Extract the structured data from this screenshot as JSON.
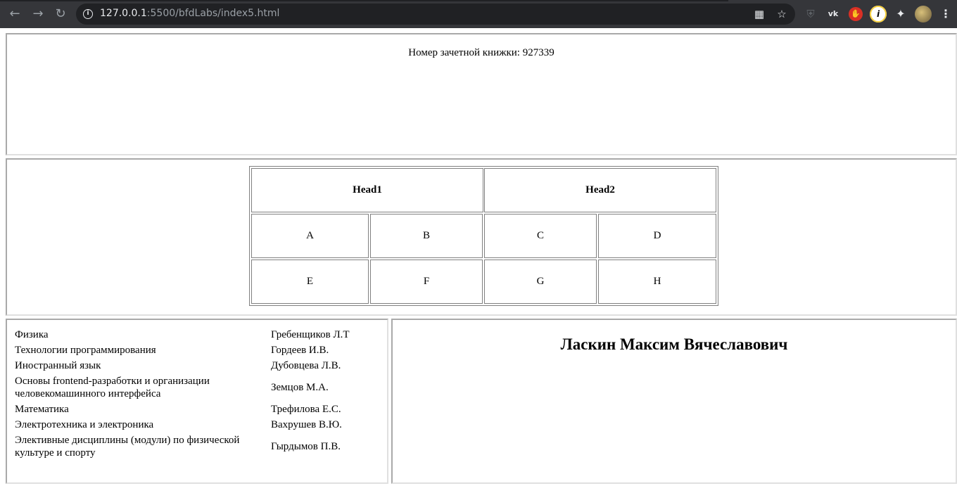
{
  "browser": {
    "url_host": "127.0.0.1",
    "url_rest": ":5500/bfdLabs/index5.html",
    "back_icon": "arrow-left-icon",
    "forward_icon": "arrow-right-icon",
    "reload_icon": "reload-icon"
  },
  "header": {
    "record_book": "Номер зачетной книжки: 927339"
  },
  "table": {
    "head1": "Head1",
    "head2": "Head2",
    "cells": [
      "A",
      "B",
      "C",
      "D",
      "E",
      "F",
      "G",
      "H"
    ]
  },
  "subjects": [
    {
      "subject": "Физика",
      "teacher": "Гребенщиков Л.Т"
    },
    {
      "subject": "Технологии программирования",
      "teacher": "Гордеев И.В."
    },
    {
      "subject": "Иностранный язык",
      "teacher": "Дубовцева Л.В."
    },
    {
      "subject": "Основы frontend-разработки и организации человекомашинного интерфейса",
      "teacher": "Земцов М.А."
    },
    {
      "subject": "Математика",
      "teacher": "Трефилова Е.С."
    },
    {
      "subject": "Электротехника и электроника",
      "teacher": "Вахрушев В.Ю."
    },
    {
      "subject": "Элективные дисциплины (модули) по физической культуре и спорту",
      "teacher": "Гырдымов П.В."
    }
  ],
  "student": {
    "name": "Ласкин Максим Вячеславович"
  }
}
